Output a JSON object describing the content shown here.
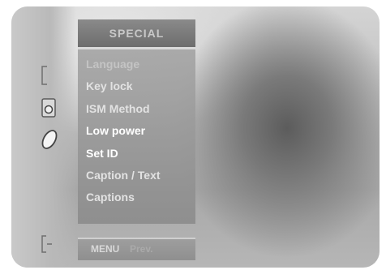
{
  "menu": {
    "title": "SPECIAL",
    "items": [
      {
        "label": "Language"
      },
      {
        "label": "Key lock"
      },
      {
        "label": "ISM Method"
      },
      {
        "label": "Low power"
      },
      {
        "label": "Set ID"
      },
      {
        "label": "Caption / Text"
      },
      {
        "label": "Captions"
      }
    ]
  },
  "footer": {
    "menu_label": "MENU",
    "prev_label": "Prev."
  },
  "side_icons": [
    "bracket-icon",
    "speaker-icon",
    "leaf-icon",
    "bracket-dash-icon"
  ],
  "colors": {
    "panel": "#9e9e9e",
    "text": "#ffffff"
  }
}
